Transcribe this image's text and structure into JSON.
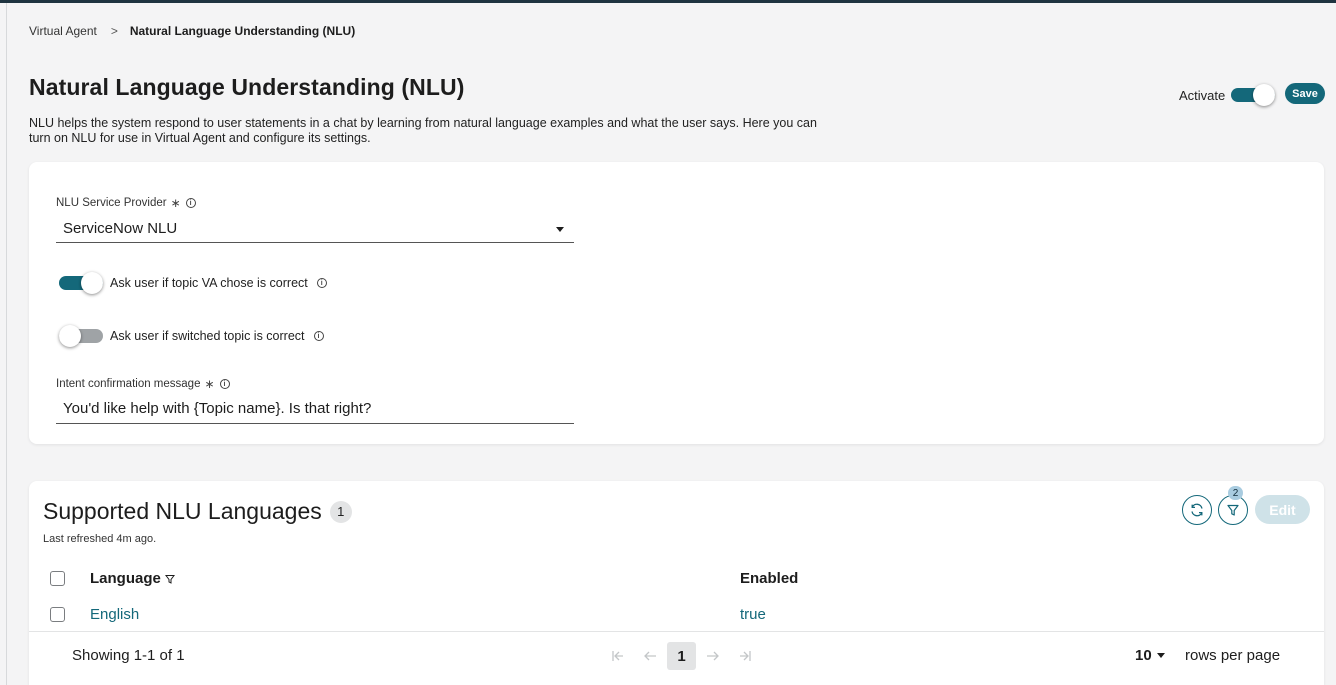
{
  "breadcrumb": {
    "parent": "Virtual Agent",
    "separator": ">",
    "current": "Natural Language Understanding (NLU)"
  },
  "header": {
    "title": "Natural Language Understanding (NLU)",
    "description": "NLU helps the system respond to user statements in a chat by learning from natural language examples and what the user says. Here you can turn on NLU for use in Virtual Agent and configure its settings.",
    "activate_label": "Activate",
    "activate_on": true,
    "save_label": "Save"
  },
  "settings": {
    "provider_label": "NLU Service Provider",
    "provider_value": "ServiceNow NLU",
    "ask_topic_label": "Ask user if topic VA chose is correct",
    "ask_topic_on": true,
    "ask_switch_label": "Ask user if switched topic is correct",
    "ask_switch_on": false,
    "intent_label": "Intent confirmation message",
    "intent_value": "You'd like help with {Topic name}. Is that right?",
    "required_mark": "∗",
    "info_glyph": "i"
  },
  "languages": {
    "title": "Supported NLU Languages",
    "count": "1",
    "refreshed": "Last refreshed 4m ago.",
    "filter_count": "2",
    "edit_label": "Edit",
    "columns": [
      "Language",
      "Enabled"
    ],
    "rows": [
      {
        "language": "English",
        "enabled": "true"
      }
    ],
    "footer": {
      "showing": "Showing 1-1 of 1",
      "page": "1",
      "rows_per_page_value": "10",
      "rows_per_page_label": "rows per page"
    }
  },
  "colors": {
    "accent": "#14687a",
    "topbar": "#1f3440",
    "edit_disabled": "#cfe2e8"
  }
}
